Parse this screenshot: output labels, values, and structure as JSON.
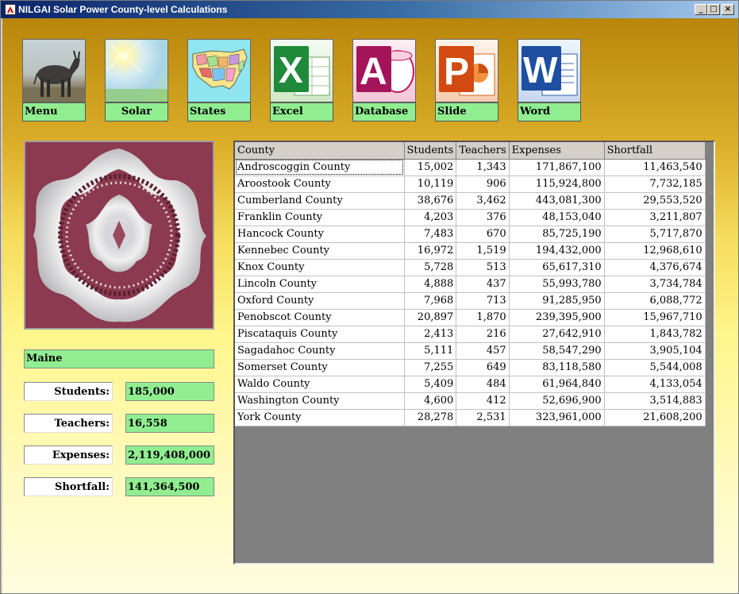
{
  "window": {
    "title": "NILGAI Solar Power County-level Calculations",
    "controls": [
      "_",
      "□",
      "×"
    ]
  },
  "toolbar": [
    {
      "label": "Menu",
      "icon": "nilgai-antelope-photo"
    },
    {
      "label": "Solar",
      "icon": "sun-photo"
    },
    {
      "label": "States",
      "icon": "us-states-map"
    },
    {
      "label": "Excel",
      "icon": "excel-icon"
    },
    {
      "label": "Database",
      "icon": "access-icon"
    },
    {
      "label": "Slide",
      "icon": "powerpoint-icon"
    },
    {
      "label": "Word",
      "icon": "word-icon"
    }
  ],
  "state": {
    "name": "Maine",
    "stats": [
      {
        "label": "Students:",
        "value": "185,000"
      },
      {
        "label": "Teachers:",
        "value": "16,558"
      },
      {
        "label": "Expenses:",
        "value": "2,119,408,000"
      },
      {
        "label": "Shortfall:",
        "value": "141,364,500"
      }
    ]
  },
  "grid": {
    "columns": [
      "County",
      "Students",
      "Teachers",
      "Expenses",
      "Shortfall"
    ],
    "selected_row": 0,
    "rows": [
      [
        "Androscoggin County",
        "15,002",
        "1,343",
        "171,867,100",
        "11,463,540"
      ],
      [
        "Aroostook County",
        "10,119",
        "906",
        "115,924,800",
        "7,732,185"
      ],
      [
        "Cumberland County",
        "38,676",
        "3,462",
        "443,081,300",
        "29,553,520"
      ],
      [
        "Franklin County",
        "4,203",
        "376",
        "48,153,040",
        "3,211,807"
      ],
      [
        "Hancock County",
        "7,483",
        "670",
        "85,725,190",
        "5,717,870"
      ],
      [
        "Kennebec County",
        "16,972",
        "1,519",
        "194,432,000",
        "12,968,610"
      ],
      [
        "Knox County",
        "5,728",
        "513",
        "65,617,310",
        "4,376,674"
      ],
      [
        "Lincoln County",
        "4,888",
        "437",
        "55,993,780",
        "3,734,784"
      ],
      [
        "Oxford County",
        "7,968",
        "713",
        "91,285,950",
        "6,088,772"
      ],
      [
        "Penobscot County",
        "20,897",
        "1,870",
        "239,395,900",
        "15,967,710"
      ],
      [
        "Piscataquis County",
        "2,413",
        "216",
        "27,642,910",
        "1,843,782"
      ],
      [
        "Sagadahoc County",
        "5,111",
        "457",
        "58,547,290",
        "3,905,104"
      ],
      [
        "Somerset County",
        "7,255",
        "649",
        "83,118,580",
        "5,544,008"
      ],
      [
        "Waldo County",
        "5,409",
        "484",
        "61,964,840",
        "4,133,054"
      ],
      [
        "Washington County",
        "4,600",
        "412",
        "52,696,900",
        "3,514,883"
      ],
      [
        "York County",
        "28,278",
        "2,531",
        "323,961,000",
        "21,608,200"
      ]
    ]
  }
}
